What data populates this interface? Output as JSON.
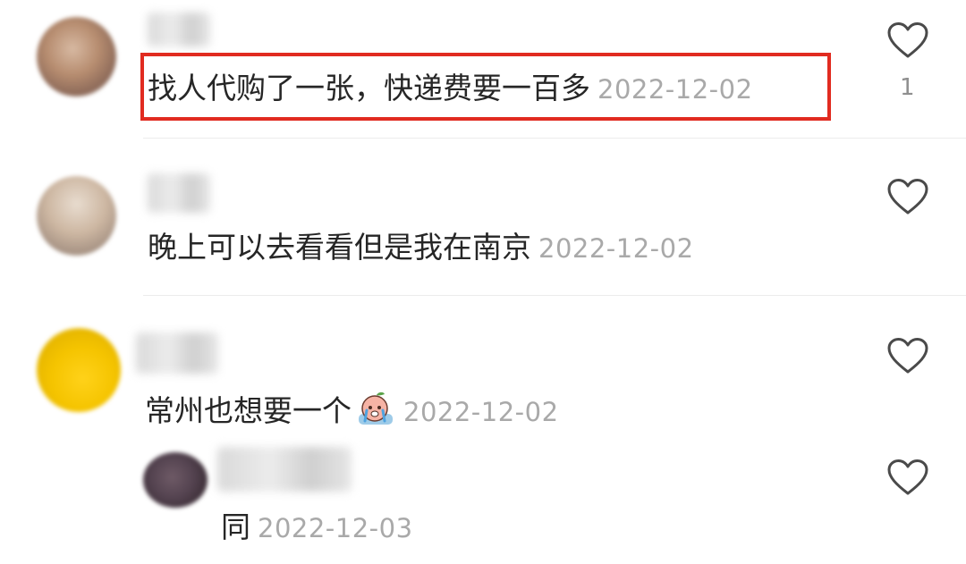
{
  "comments": [
    {
      "text": "找人代购了一张，快递费要一百多",
      "date": "2022-12-02",
      "likes": "1"
    },
    {
      "text": "晚上可以去看看但是我在南京",
      "date": "2022-12-02"
    },
    {
      "text": "常州也想要一个",
      "date": "2022-12-02",
      "emoji": "crying-face-emoji"
    },
    {
      "text": "同",
      "date": "2022-12-03"
    }
  ],
  "colors": {
    "highlight": "#e12b20",
    "text": "#262626",
    "timestamp": "#a9a9a9",
    "icon": "#4a4a4a"
  }
}
